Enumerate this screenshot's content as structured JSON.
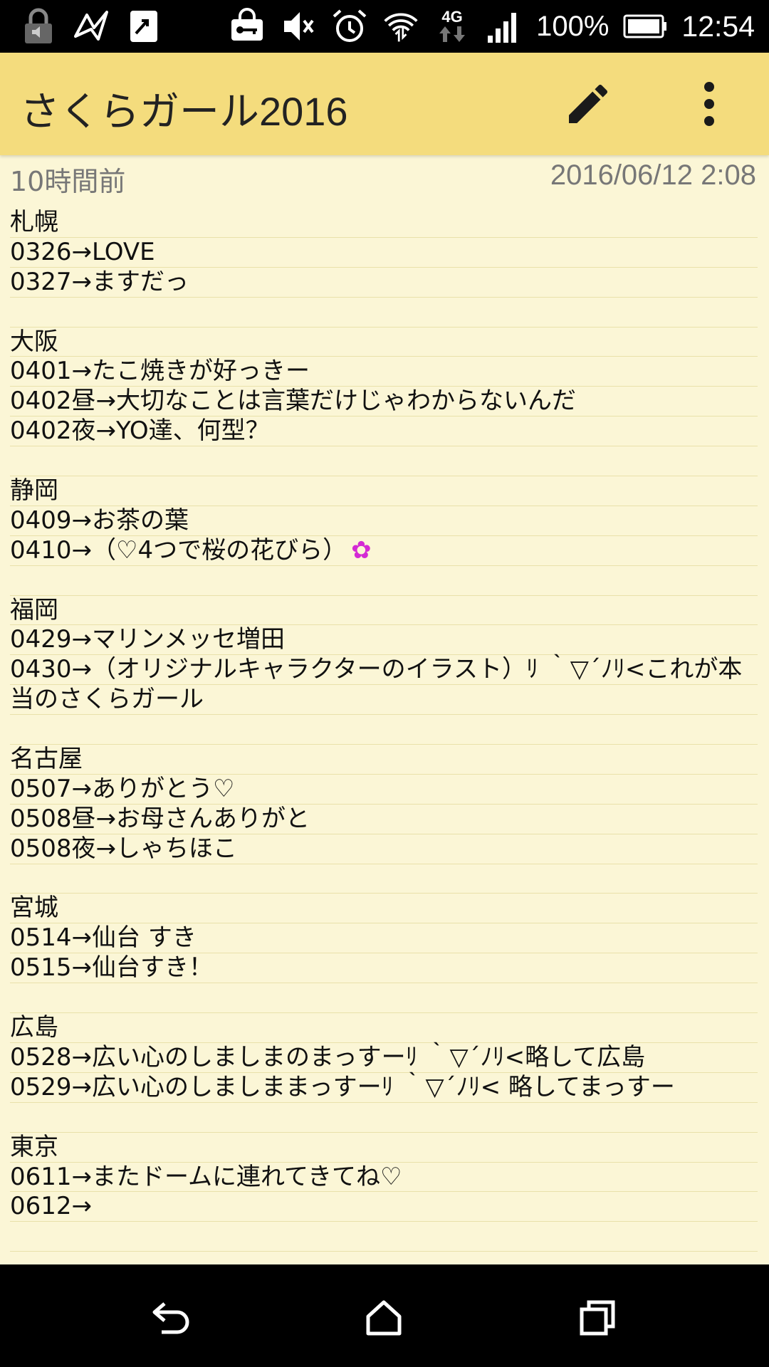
{
  "status_bar": {
    "battery_percent": "100%",
    "time": "12:54",
    "network_label": "4G",
    "left_icons": [
      "lock-sound-icon",
      "bird-app-icon",
      "share-app-icon"
    ],
    "right_icons": [
      "vpn-key-icon",
      "mute-icon",
      "alarm-icon",
      "wifi-icon",
      "mobile-data-icon",
      "signal-icon",
      "battery-icon"
    ]
  },
  "app_bar": {
    "title": "さくらガール2016",
    "background_color": "#f4dc7d",
    "actions": [
      "edit-pencil-icon",
      "more-vert-icon"
    ]
  },
  "note": {
    "relative_time": "10時間前",
    "timestamp": "2016/06/12 2:08",
    "background_color": "#fbf6d6",
    "lines": [
      "札幌",
      "0326→LOVE",
      "0327→ますだっ",
      "",
      "大阪",
      "0401→たこ焼きが好っきー",
      "0402昼→大切なことは言葉だけじゃわからないんだ",
      "0402夜→YO達、何型？",
      "",
      "静岡",
      "0409→お茶の葉",
      "0410→（♡4つで桜の花びら）",
      "",
      "福岡",
      "0429→マリンメッセ増田",
      "0430→（オリジナルキャラクターのイラスト）ﾘ ｀▽´ﾉﾘ<これが本",
      "当のさくらガール",
      "",
      "名古屋",
      "0507→ありがとう♡",
      "0508昼→お母さんありがと",
      "0508夜→しゃちほこ",
      "",
      "宮城",
      "0514→仙台 すき",
      "0515→仙台すき！",
      "",
      "広島",
      "0528→広い心のしましまのまっすーﾘ ｀▽´ﾉﾘ<略して広島",
      "0529→広い心のしましままっすーﾘ ｀▽´ﾉﾘ< 略してまっすー",
      "",
      "東京",
      "0611→またドームに連れてきてね♡",
      "0612→",
      ""
    ],
    "flower_emoji": "✿"
  },
  "nav_bar": {
    "buttons": [
      "back-icon",
      "home-icon",
      "recents-icon"
    ]
  }
}
